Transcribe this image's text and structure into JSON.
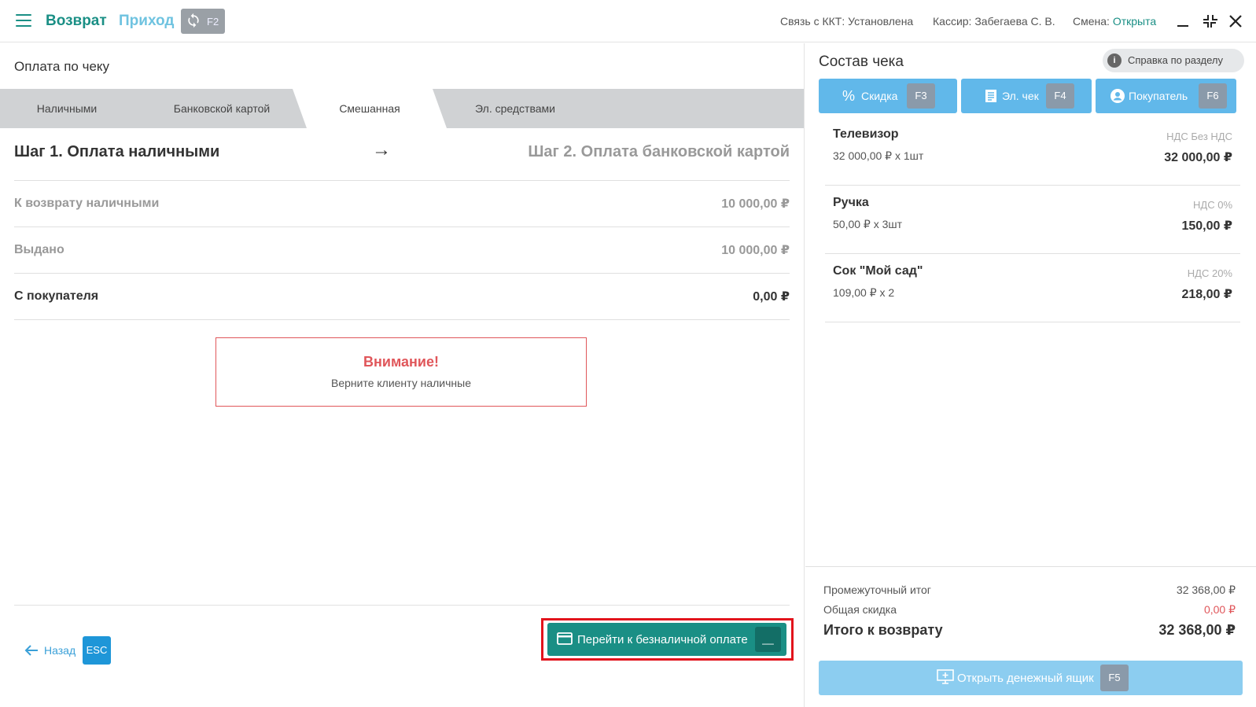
{
  "header": {
    "mode_return": "Возврат",
    "mode_income": "Приход",
    "switch_key": "F2",
    "kkt_label": "Связь с ККТ: Установлена",
    "cashier_label": "Кассир: Забегаева С. В.",
    "shift_label": "Смена:",
    "shift_value": "Открыта"
  },
  "payment": {
    "title": "Оплата по чеку",
    "tabs": [
      {
        "label": "Наличными"
      },
      {
        "label": "Банковской картой"
      },
      {
        "label": "Смешанная",
        "active": true
      },
      {
        "label": "Эл. средствами"
      }
    ],
    "step1": "Шаг 1. Оплата наличными",
    "step_arrow": "→",
    "step2": "Шаг 2. Оплата банковской картой",
    "rows": [
      {
        "label": "К возврату наличными",
        "value": "10 000,00 ₽"
      },
      {
        "label": "Выдано",
        "value": "10 000,00 ₽"
      },
      {
        "label": "С покупателя",
        "value": "0,00 ₽"
      }
    ],
    "alert_title": "Внимание!",
    "alert_text": "Верните клиенту наличные",
    "back_label": "Назад",
    "back_key": "ESC",
    "go_label": "Перейти к безналичной оплате",
    "go_key": "__"
  },
  "receipt": {
    "title": "Состав чека",
    "help_label": "Справка по разделу",
    "buttons": [
      {
        "label": "Скидка",
        "key": "F3",
        "icon": "percent-icon"
      },
      {
        "label": "Эл. чек",
        "key": "F4",
        "icon": "receipt-icon"
      },
      {
        "label": "Покупатель",
        "key": "F6",
        "icon": "user-icon"
      }
    ],
    "items": [
      {
        "name": "Телевизор",
        "qty": "32 000,00 ₽ x 1шт",
        "vat": "НДС Без НДС",
        "sum": "32 000,00 ₽"
      },
      {
        "name": "Ручка",
        "qty": "50,00 ₽ x 3шт",
        "vat": "НДС 0%",
        "sum": "150,00 ₽"
      },
      {
        "name": "Сок \"Мой сад\"",
        "qty": "109,00 ₽ x 2",
        "vat": "НДС 20%",
        "sum": "218,00 ₽"
      }
    ],
    "subtotal_label": "Промежуточный итог",
    "subtotal_value": "32 368,00 ₽",
    "discount_label": "Общая скидка",
    "discount_value": "0,00 ₽",
    "total_label": "Итого к возврату",
    "total_value": "32 368,00 ₽",
    "drawer_label": "Открыть денежный ящик",
    "drawer_key": "F5"
  },
  "colors": {
    "accent": "#1a8f85",
    "blue": "#61b8ea",
    "alert": "#e0565a"
  }
}
